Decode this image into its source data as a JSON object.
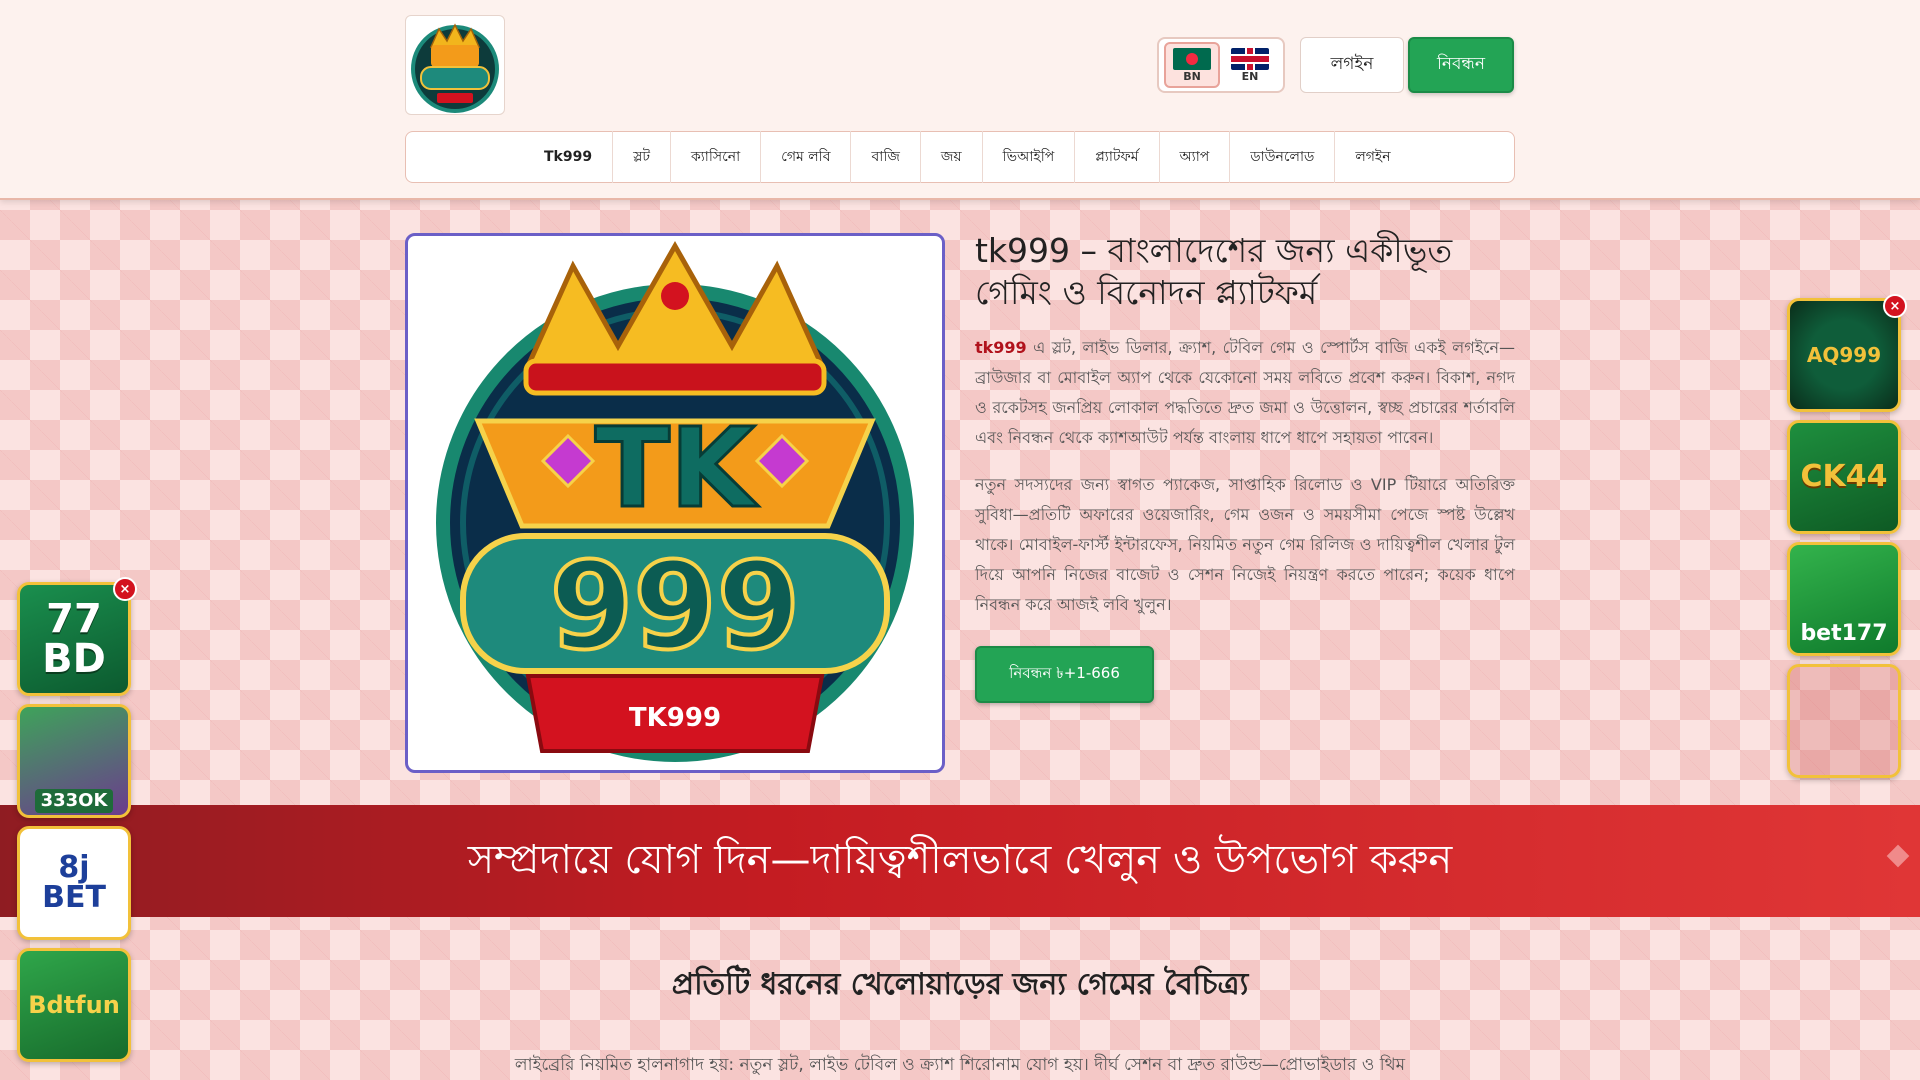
{
  "header": {
    "logo_text": "TK 999",
    "lang": [
      {
        "code": "BN",
        "active": true
      },
      {
        "code": "EN",
        "active": false
      }
    ],
    "login_label": "লগইন",
    "register_label": "নিবন্ধন"
  },
  "nav": {
    "items": [
      "Tk999",
      "স্লট",
      "ক্যাসিনো",
      "গেম লবি",
      "বাজি",
      "জয়",
      "ভিআইপি",
      "প্ল্যাটফর্ম",
      "অ্যাপ",
      "ডাউনলোড",
      "লগইন"
    ]
  },
  "hero": {
    "image_text_top": "TK",
    "image_text_mid": "999",
    "image_text_ribbon": "TK999",
    "title": "tk999 – বাংলাদেশের জন্য একীভূত গেমিং ও বিনোদন প্ল্যাটফর্ম",
    "p1_brand": "tk999",
    "p1_rest": " এ স্লট, লাইভ ডিলার, ক্র্যাশ, টেবিল গেম ও স্পোর্টস বাজি একই লগইনে—ব্রাউজার বা মোবাইল অ্যাপ থেকে যেকোনো সময় লবিতে প্রবেশ করুন। বিকাশ, নগদ ও রকেটসহ জনপ্রিয় লোকাল পদ্ধতিতে দ্রুত জমা ও উত্তোলন, স্বচ্ছ প্রচারের শর্তাবলি এবং নিবন্ধন থেকে ক্যাশআউট পর্যন্ত বাংলায় ধাপে ধাপে সহায়তা পাবেন।",
    "p2": "নতুন সদস্যদের জন্য স্বাগত প্যাকেজ, সাপ্তাহিক রিলোড ও VIP টিয়ারে অতিরিক্ত সুবিধা—প্রতিটি অফারের ওয়েজারিং, গেম ওজন ও সময়সীমা পেজে স্পষ্ট উল্লেখ থাকে। মোবাইল-ফার্স্ট ইন্টারফেস, নিয়মিত নতুন গেম রিলিজ ও দায়িত্বশীল খেলার টুল দিয়ে আপনি নিজের বাজেট ও সেশন নিজেই নিয়ন্ত্রণ করতে পারেন; কয়েক ধাপে নিবন্ধন করে আজই লবি খুলুন।",
    "cta_label": "নিবন্ধন ৳+1-666"
  },
  "banner": {
    "text": "সম্প্রদায়ে যোগ দিন—দায়িত্বশীলভাবে খেলুন ও উপভোগ করুন"
  },
  "section": {
    "title": "প্রতিটি ধরনের খেলোয়াড়ের জন্য গেমের বৈচিত্র্য",
    "p": "লাইব্রেরি নিয়মিত হালনাগাদ হয়: নতুন স্লট, লাইভ টেবিল ও ক্র্যাশ শিরোনাম যোগ হয়। দীর্ঘ সেশন বা দ্রুত রাউন্ড—প্রোভাইডার ও থিম"
  },
  "ads_left": [
    {
      "label": "77\nBD",
      "close": "×"
    },
    {
      "label": "333OK"
    },
    {
      "label": "8j\nBET"
    },
    {
      "label": "Bdtfun"
    }
  ],
  "ads_right": [
    {
      "label": "AQ999",
      "close": "×"
    },
    {
      "label": "CK44"
    },
    {
      "label": "bet177"
    },
    {
      "label": ""
    }
  ],
  "colors": {
    "accent_green": "#23a455",
    "brand_red": "#b1121c",
    "banner_red": "#c41c22"
  }
}
